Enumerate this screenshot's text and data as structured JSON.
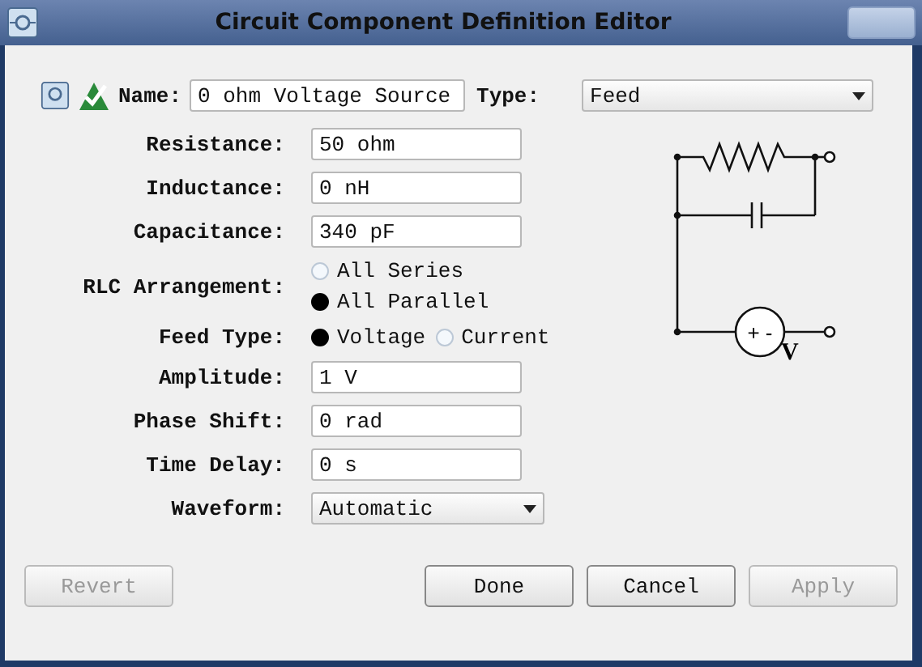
{
  "window": {
    "title": "Circuit Component Definition Editor"
  },
  "header": {
    "name_label": "Name:",
    "name_value": "0 ohm Voltage Source",
    "type_label": "Type:",
    "type_value": "Feed"
  },
  "fields": [
    {
      "kind": "text",
      "label": "Resistance:",
      "value": "50 ohm"
    },
    {
      "kind": "text",
      "label": "Inductance:",
      "value": "0 nH"
    },
    {
      "kind": "text",
      "label": "Capacitance:",
      "value": "340 pF"
    },
    {
      "kind": "radio-stack",
      "label": "RLC Arrangement:",
      "options": [
        {
          "label": "All Series",
          "selected": false
        },
        {
          "label": "All Parallel",
          "selected": true
        }
      ]
    },
    {
      "kind": "radio-row",
      "label": "Feed Type:",
      "options": [
        {
          "label": "Voltage",
          "selected": true
        },
        {
          "label": "Current",
          "selected": false
        }
      ]
    },
    {
      "kind": "text",
      "label": "Amplitude:",
      "value": "1 V"
    },
    {
      "kind": "text",
      "label": "Phase Shift:",
      "value": "0 rad"
    },
    {
      "kind": "text",
      "label": "Time Delay:",
      "value": "0 s"
    },
    {
      "kind": "select",
      "label": "Waveform:",
      "value": "Automatic"
    }
  ],
  "diagram": {
    "polarity": "+ -",
    "source_label": "V"
  },
  "buttons": [
    {
      "label": "Revert",
      "disabled": true
    },
    {
      "label": "Done",
      "disabled": false
    },
    {
      "label": "Cancel",
      "disabled": false
    },
    {
      "label": "Apply",
      "disabled": true
    }
  ]
}
